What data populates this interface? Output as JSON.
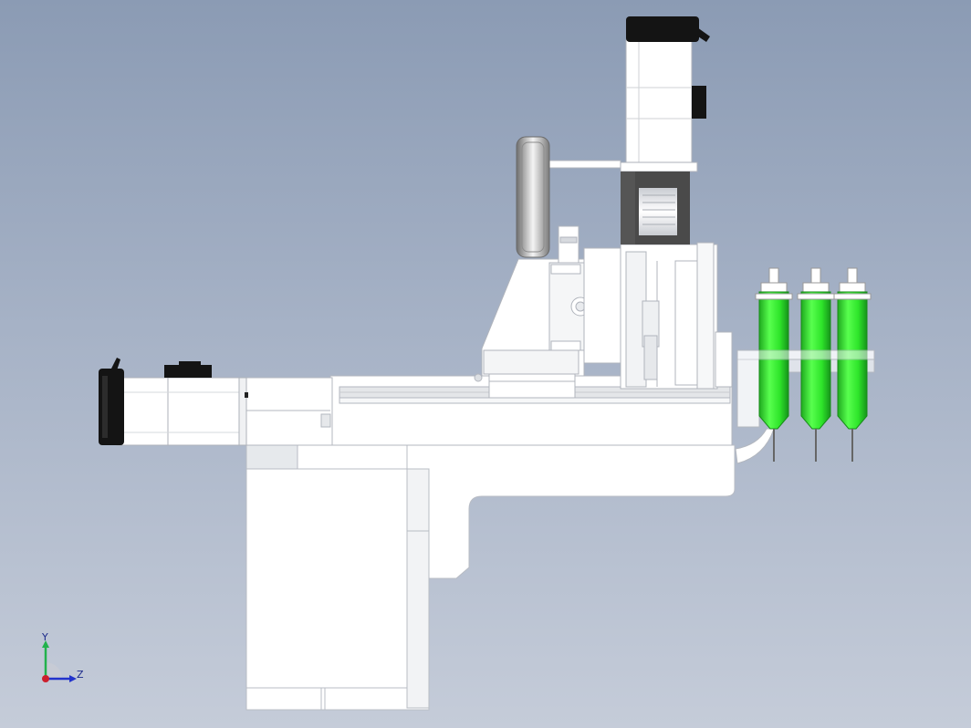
{
  "viewport": {
    "background_top": "#8b9bb4",
    "background_bottom": "#c5ccd9"
  },
  "triad": {
    "y_label": "Y",
    "z_label": "Z",
    "y_color": "#22b24c",
    "z_color": "#2233cc",
    "origin_color": "#cc1f2d"
  },
  "model": {
    "syringe_color": "#2ee52a",
    "motor_color": "#141414",
    "bracket_color": "#4a4a4a",
    "body_color": "#ffffff"
  }
}
